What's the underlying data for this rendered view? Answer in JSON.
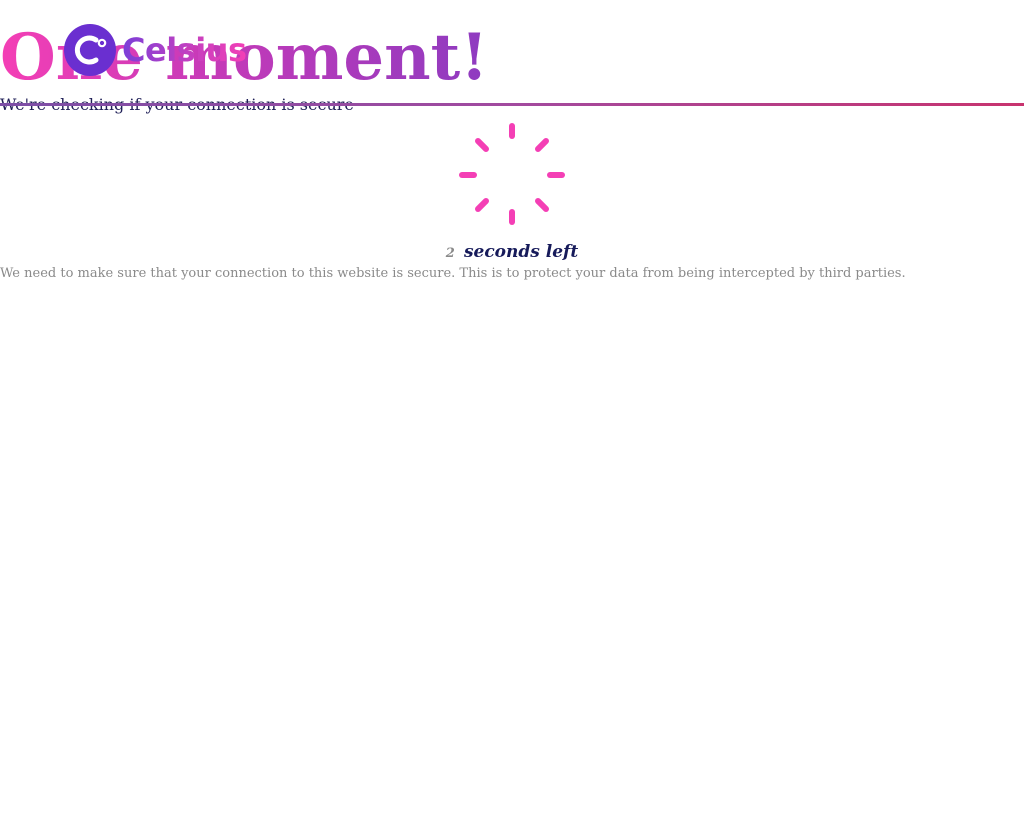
{
  "headline": "One moment!",
  "logo": {
    "wordmark": "Celsius",
    "icon": "celsius-logo-icon",
    "colors": {
      "mark": "#6a2fd0",
      "wordmark_start": "#7b3fd8",
      "wordmark_end": "#f43fb5"
    }
  },
  "subtitle": "We're checking if your connection is secure",
  "spinner": {
    "icon": "loading-spinner-icon",
    "color": "#f43fb5"
  },
  "countdown": {
    "seconds": "2",
    "label": "seconds left"
  },
  "description": "We need to make sure that your connection to this website is secure. This is to protect your data from being intercepted by third parties.",
  "colors": {
    "headline_start": "#f43fb5",
    "headline_end": "#8e3bc0",
    "subtitle_text": "#1f1f57",
    "countdown_label": "#161a5a",
    "muted_text": "#8a8a8a",
    "divider_start": "#7c4ea6",
    "divider_end": "#c8336e"
  }
}
